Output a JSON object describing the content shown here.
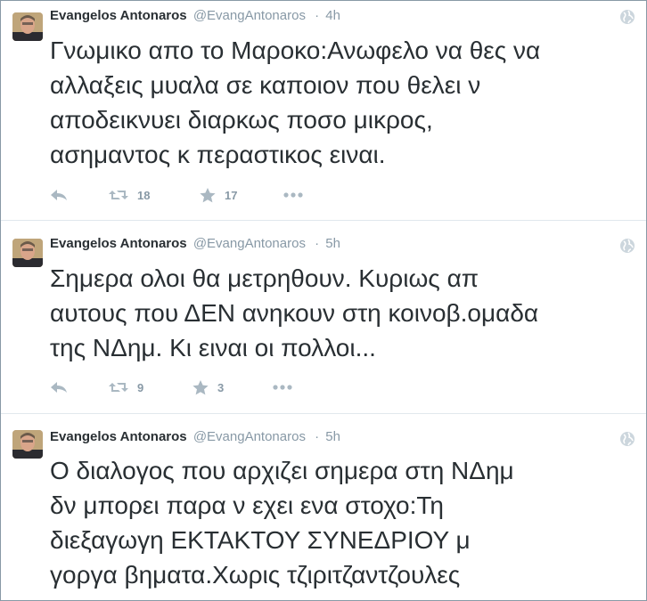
{
  "tweets": [
    {
      "name": "Evangelos Antonaros",
      "handle": "@EvangAntonaros",
      "separator": "·",
      "time": "4h",
      "lines": [
        "Γνωμικο απο το Μαροκο:Ανωφελο να θες να",
        "αλλαξεις μυαλα σε καποιον που θελει ν",
        "αποδεικνυει διαρκως ποσο μικρος,",
        "ασημαντος κ περαστικος ειναι."
      ],
      "retweets": "18",
      "favorites": "17"
    },
    {
      "name": "Evangelos Antonaros",
      "handle": "@EvangAntonaros",
      "separator": "·",
      "time": "5h",
      "lines": [
        "Σημερα ολοι θα μετρηθουν. Κυριως απ",
        "αυτους που ΔΕΝ ανηκουν στη κοινοβ.ομαδα",
        "της ΝΔημ. Κι ειναι οι πολλοι..."
      ],
      "retweets": "9",
      "favorites": "3"
    },
    {
      "name": "Evangelos Antonaros",
      "handle": "@EvangAntonaros",
      "separator": "·",
      "time": "5h",
      "lines": [
        "Ο διαλογος που αρχιζει σημερα στη ΝΔημ",
        "δν μπορει παρα ν εχει ενα στοχο:Τη",
        "διεξαγωγη ΕΚΤΑΚΤΟΥ ΣΥΝΕΔΡΙΟΥ μ",
        "γοργα βηματα.Χωρις τζιριτζαντζουλες"
      ]
    }
  ],
  "icons": {
    "reply": "reply-icon",
    "retweet": "retweet-icon",
    "favorite": "star-icon",
    "more": "more-icon",
    "globe": "globe-icon"
  },
  "colors": {
    "text": "#292f33",
    "muted": "#8899a6",
    "icon": "#aab8c2",
    "divider": "#e1e8ed"
  }
}
